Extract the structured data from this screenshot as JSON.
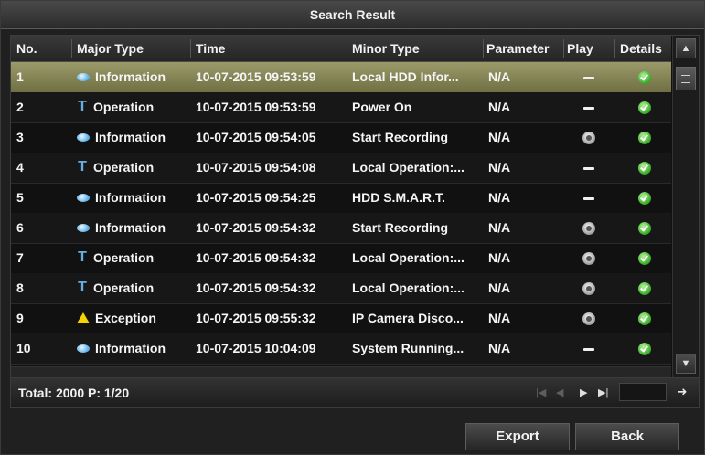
{
  "window": {
    "title": "Search Result"
  },
  "table": {
    "columns": {
      "no": "No.",
      "major_type": "Major Type",
      "time": "Time",
      "minor_type": "Minor Type",
      "parameter": "Parameter",
      "play": "Play",
      "details": "Details"
    },
    "rows": [
      {
        "no": "1",
        "major_type": "Information",
        "type_icon": "info",
        "time": "10-07-2015 09:53:59",
        "minor_type": "Local HDD Infor...",
        "parameter": "N/A",
        "play": "dash",
        "details": "check",
        "selected": true
      },
      {
        "no": "2",
        "major_type": "Operation",
        "type_icon": "operation",
        "time": "10-07-2015 09:53:59",
        "minor_type": "Power On",
        "parameter": "N/A",
        "play": "dash",
        "details": "check"
      },
      {
        "no": "3",
        "major_type": "Information",
        "type_icon": "info",
        "time": "10-07-2015 09:54:05",
        "minor_type": "Start Recording",
        "parameter": "N/A",
        "play": "button",
        "details": "check"
      },
      {
        "no": "4",
        "major_type": "Operation",
        "type_icon": "operation",
        "time": "10-07-2015 09:54:08",
        "minor_type": "Local Operation:...",
        "parameter": "N/A",
        "play": "dash",
        "details": "check"
      },
      {
        "no": "5",
        "major_type": "Information",
        "type_icon": "info",
        "time": "10-07-2015 09:54:25",
        "minor_type": "HDD S.M.A.R.T.",
        "parameter": "N/A",
        "play": "dash",
        "details": "check"
      },
      {
        "no": "6",
        "major_type": "Information",
        "type_icon": "info",
        "time": "10-07-2015 09:54:32",
        "minor_type": "Start Recording",
        "parameter": "N/A",
        "play": "button",
        "details": "check"
      },
      {
        "no": "7",
        "major_type": "Operation",
        "type_icon": "operation",
        "time": "10-07-2015 09:54:32",
        "minor_type": "Local Operation:...",
        "parameter": "N/A",
        "play": "button",
        "details": "check"
      },
      {
        "no": "8",
        "major_type": "Operation",
        "type_icon": "operation",
        "time": "10-07-2015 09:54:32",
        "minor_type": "Local Operation:...",
        "parameter": "N/A",
        "play": "button",
        "details": "check"
      },
      {
        "no": "9",
        "major_type": "Exception",
        "type_icon": "exception",
        "time": "10-07-2015 09:55:32",
        "minor_type": "IP Camera Disco...",
        "parameter": "N/A",
        "play": "button",
        "details": "check"
      },
      {
        "no": "10",
        "major_type": "Information",
        "type_icon": "info",
        "time": "10-07-2015 10:04:09",
        "minor_type": "System Running...",
        "parameter": "N/A",
        "play": "dash",
        "details": "check"
      }
    ]
  },
  "footer": {
    "total": "Total: 2000  P: 1/20",
    "page_value": ""
  },
  "buttons": {
    "export": "Export",
    "back": "Back"
  },
  "colors": {
    "selected_row": "#8a8a5a",
    "check": "#34a924",
    "info": "#5aaee8",
    "exception": "#f6d200"
  }
}
